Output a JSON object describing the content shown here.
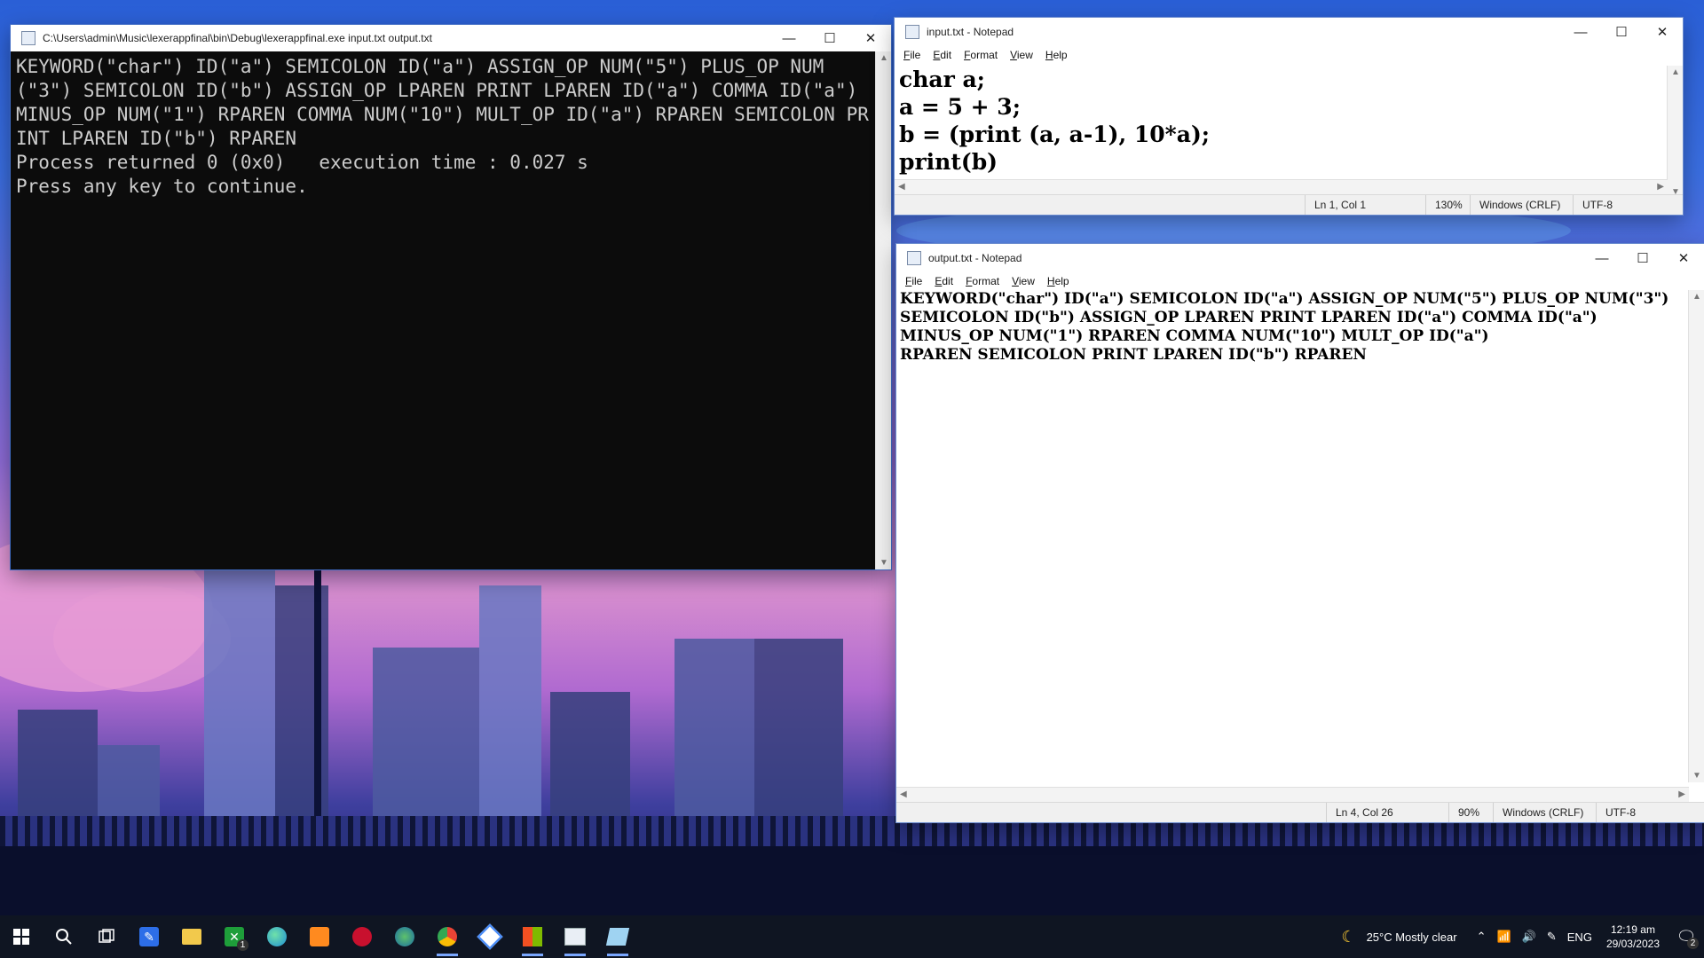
{
  "console": {
    "title": "C:\\Users\\admin\\Music\\lexerappfinal\\bin\\Debug\\lexerappfinal.exe input.txt output.txt",
    "lines": [
      "KEYWORD(\"char\") ID(\"a\") SEMICOLON ID(\"a\") ASSIGN_OP NUM(\"5\") PLUS_OP NUM(\"3\") SEMICOLON ID(\"b\") ASSIGN_OP LPAREN PRINT LPAREN ID(\"a\") COMMA ID(\"a\") MINUS_OP NUM(\"1\") RPAREN COMMA NUM(\"10\") MULT_OP ID(\"a\") RPAREN SEMICOLON PRINT LPAREN ID(\"b\") RPAREN",
      "Process returned 0 (0x0)   execution time : 0.027 s",
      "Press any key to continue."
    ]
  },
  "input_notepad": {
    "title": "input.txt - Notepad",
    "menu": [
      "File",
      "Edit",
      "Format",
      "View",
      "Help"
    ],
    "lines": [
      "char a;",
      "a = 5 + 3;",
      "b = (print (a, a-1), 10*a);",
      "print(b)"
    ],
    "status": {
      "position": "Ln 1, Col 1",
      "zoom": "130%",
      "line_ending": "Windows (CRLF)",
      "encoding": "UTF-8"
    }
  },
  "output_notepad": {
    "title": "output.txt - Notepad",
    "menu": [
      "File",
      "Edit",
      "Format",
      "View",
      "Help"
    ],
    "lines": [
      "KEYWORD(\"char\") ID(\"a\") SEMICOLON ID(\"a\") ASSIGN_OP NUM(\"5\") PLUS_OP NUM(\"3\")",
      "SEMICOLON ID(\"b\") ASSIGN_OP LPAREN PRINT LPAREN ID(\"a\") COMMA ID(\"a\")",
      "MINUS_OP NUM(\"1\") RPAREN COMMA NUM(\"10\") MULT_OP ID(\"a\")",
      "RPAREN SEMICOLON PRINT LPAREN ID(\"b\") RPAREN"
    ],
    "status": {
      "position": "Ln 4, Col 26",
      "zoom": "90%",
      "line_ending": "Windows (CRLF)",
      "encoding": "UTF-8"
    }
  },
  "window_controls": {
    "minimize": "—",
    "maximize": "☐",
    "close": "✕"
  },
  "taskbar": {
    "apps": [
      "windows-start-icon",
      "search-icon",
      "task-view-icon",
      "whiteboard-icon",
      "file-explorer-icon",
      "xbox-icon",
      "edge-icon",
      "sublime-text-icon",
      "app-red-icon",
      "app-globe-icon",
      "chrome-icon",
      "box-app-icon",
      "store-icon",
      "terminal-icon",
      "notepad-icon"
    ],
    "xbox_badge": "1",
    "weather": "25°C  Mostly clear",
    "language": "ENG",
    "time": "12:19 am",
    "date": "29/03/2023",
    "notifications": "2"
  }
}
